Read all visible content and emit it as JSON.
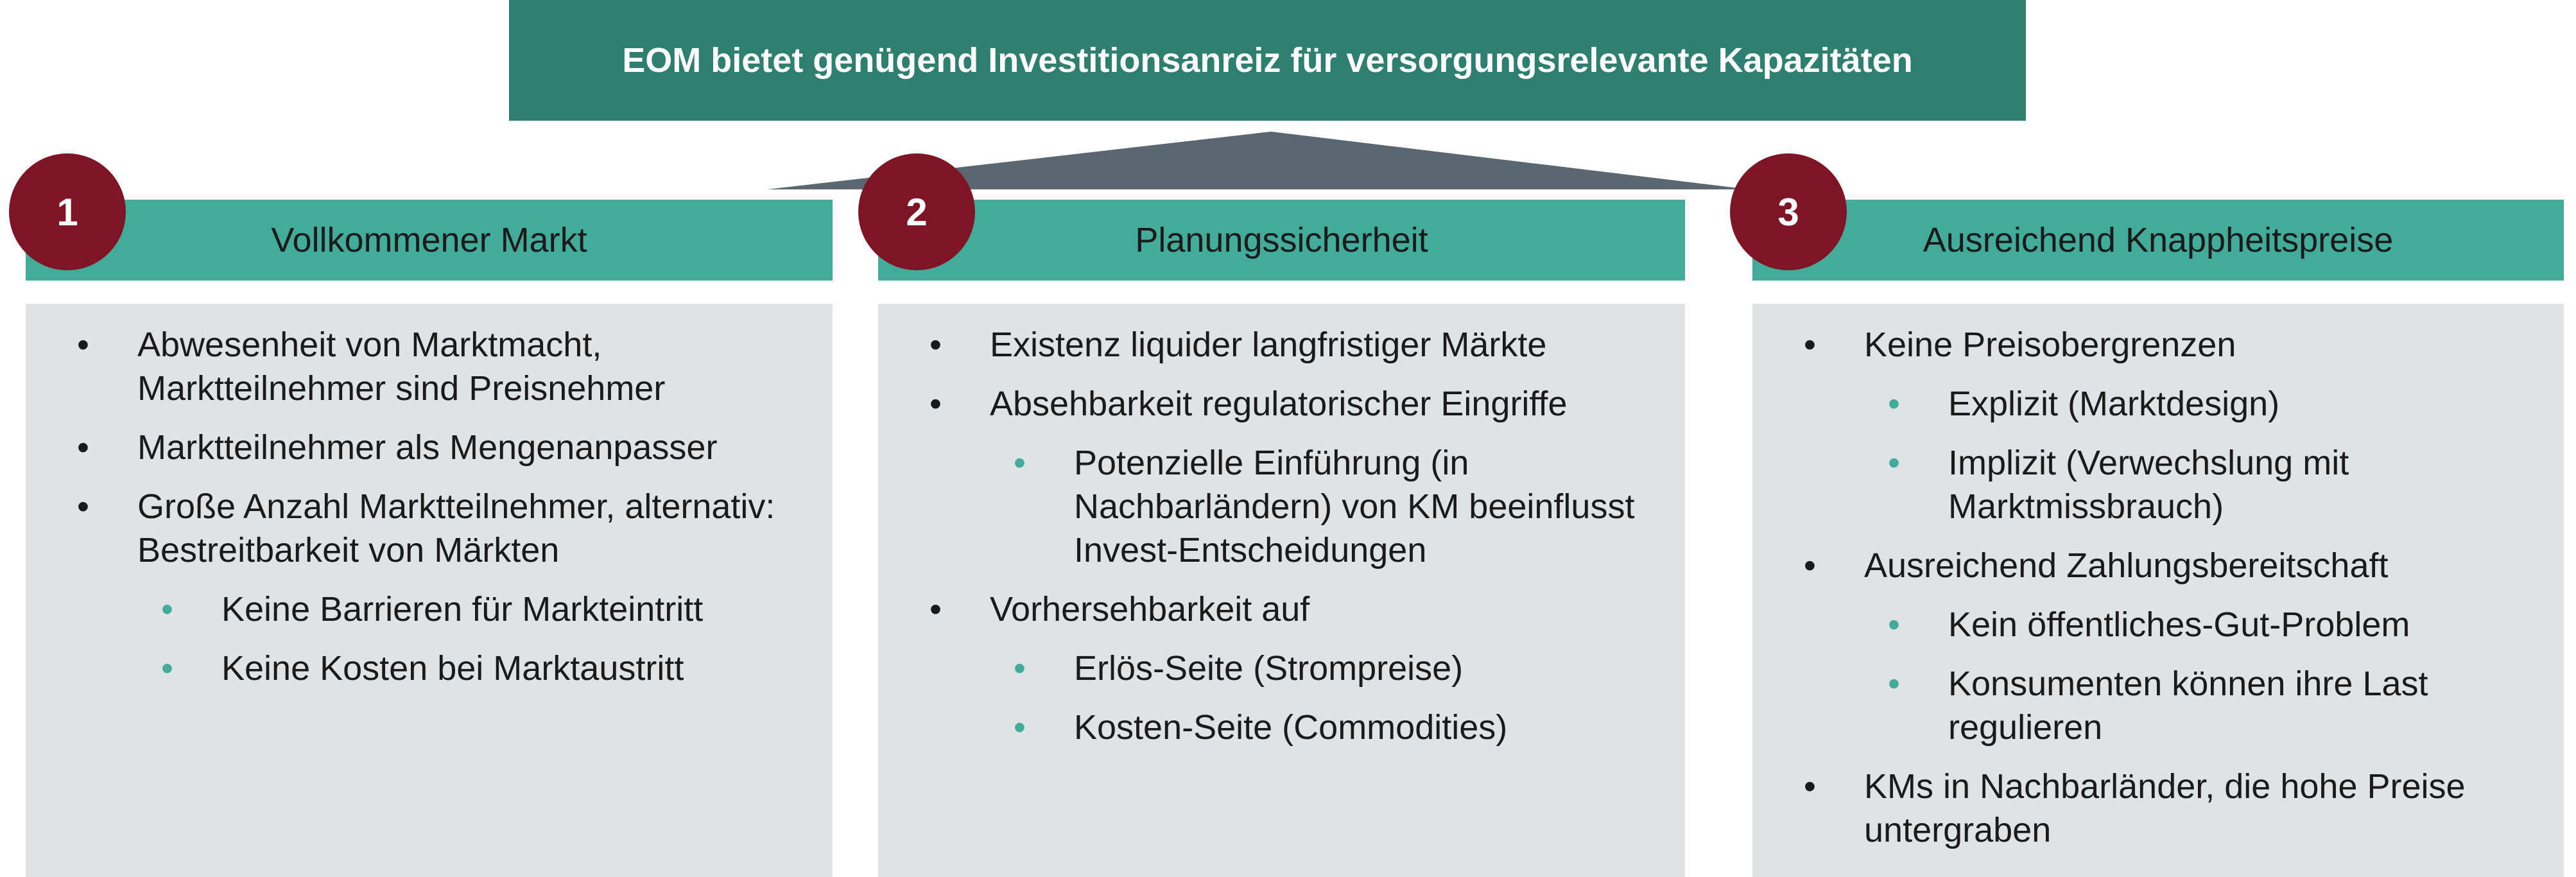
{
  "banner": {
    "title": "EOM bietet genügend Investitionsanreiz für versorgungsrelevante Kapazitäten"
  },
  "colors": {
    "banner": "#2e7f6f",
    "header": "#43ab9a",
    "badge": "#7e1525",
    "body": "#e0e3e6",
    "roof": "#5b6770",
    "sub_bullet": "#43ab9a"
  },
  "columns": [
    {
      "number": "1",
      "title": "Vollkommener Markt",
      "items": [
        {
          "text": "Abwesenheit von Marktmacht, Marktteilnehmer sind Preisnehmer",
          "level": 1
        },
        {
          "text": "Marktteilnehmer als Mengenanpasser",
          "level": 1
        },
        {
          "text": "Große Anzahl Marktteilnehmer, alternativ: Bestreitbarkeit von Märkten",
          "level": 1
        },
        {
          "text": "Keine Barrieren für Markteintritt",
          "level": 2
        },
        {
          "text": "Keine Kosten bei Marktaustritt",
          "level": 2
        }
      ]
    },
    {
      "number": "2",
      "title": "Planungssicherheit",
      "items": [
        {
          "text": "Existenz liquider langfristiger Märkte",
          "level": 1
        },
        {
          "text": "Absehbarkeit regulatorischer Eingriffe",
          "level": 1
        },
        {
          "text": "Potenzielle Einführung (in Nachbarländern) von KM beeinflusst Invest-Entscheidungen",
          "level": 2
        },
        {
          "text": "Vorhersehbarkeit auf",
          "level": 1
        },
        {
          "text": "Erlös-Seite (Strompreise)",
          "level": 2
        },
        {
          "text": "Kosten-Seite (Commodities)",
          "level": 2
        }
      ]
    },
    {
      "number": "3",
      "title": "Ausreichend Knappheitspreise",
      "items": [
        {
          "text": "Keine Preisobergrenzen",
          "level": 1
        },
        {
          "text": "Explizit (Marktdesign)",
          "level": 2
        },
        {
          "text": "Implizit (Verwechslung mit Marktmissbrauch)",
          "level": 2
        },
        {
          "text": "Ausreichend Zahlungsbereitschaft",
          "level": 1
        },
        {
          "text": "Kein öffentliches-Gut-Problem",
          "level": 2
        },
        {
          "text": "Konsumenten können ihre Last regulieren",
          "level": 2
        },
        {
          "text": "KMs in Nachbarländer, die hohe Preise untergraben",
          "level": 1
        }
      ]
    }
  ]
}
